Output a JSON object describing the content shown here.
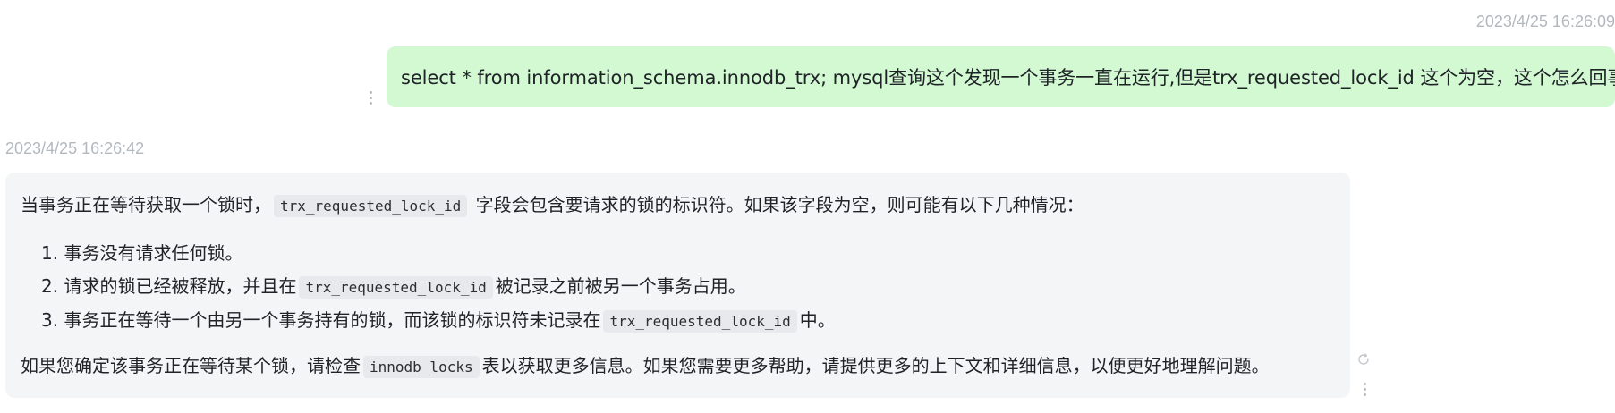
{
  "conversation": {
    "user_message": {
      "timestamp": "2023/4/25 16:26:09",
      "text": "select * from information_schema.innodb_trx; mysql查询这个发现一个事务一直在运行,但是trx_requested_lock_id 这个为空，这个怎么回事"
    },
    "assistant_message": {
      "timestamp": "2023/4/25 16:26:42",
      "intro_before": "当事务正在等待获取一个锁时，",
      "intro_code": "trx_requested_lock_id",
      "intro_after": "字段会包含要请求的锁的标识符。如果该字段为空，则可能有以下几种情况：",
      "items": [
        {
          "num": "1.",
          "text_before": "事务没有请求任何锁。"
        },
        {
          "num": "2.",
          "text_before": "请求的锁已经被释放，并且在",
          "code": "trx_requested_lock_id",
          "text_after": "被记录之前被另一个事务占用。"
        },
        {
          "num": "3.",
          "text_before": "事务正在等待一个由另一个事务持有的锁，而该锁的标识符未记录在",
          "code": "trx_requested_lock_id",
          "text_after": "中。"
        }
      ],
      "outro_before": "如果您确定该事务正在等待某个锁，请检查",
      "outro_code": "innodb_locks",
      "outro_after": "表以获取更多信息。如果您需要更多帮助，请提供更多的上下文和详细信息，以便更好地理解问题。"
    }
  },
  "icons": {
    "user_more": "more-vertical-icon",
    "bot_more": "more-vertical-icon",
    "regenerate": "reload-icon"
  },
  "colors": {
    "user_bubble": "#d2f9d1",
    "assistant_bubble": "#f4f5f7",
    "timestamp": "#b3b8bf",
    "inline_code_bg": "#e8e9ec"
  }
}
